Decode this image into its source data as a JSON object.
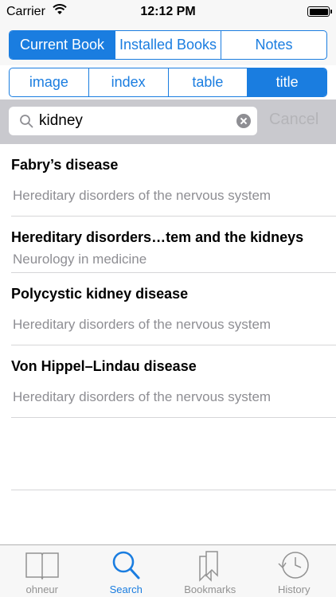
{
  "status_bar": {
    "carrier": "Carrier",
    "time": "12:12 PM"
  },
  "scope_tabs": [
    {
      "label": "Current Book",
      "active": true
    },
    {
      "label": "Installed Books",
      "active": false
    },
    {
      "label": "Notes",
      "active": false
    }
  ],
  "field_tabs": [
    {
      "label": "image",
      "active": false
    },
    {
      "label": "index",
      "active": false
    },
    {
      "label": "table",
      "active": false
    },
    {
      "label": "title",
      "active": true
    }
  ],
  "search": {
    "value": "kidney",
    "cancel_label": "Cancel"
  },
  "results": [
    {
      "title": "Fabry’s disease",
      "subtitle": "Hereditary disorders of the nervous system"
    },
    {
      "title": "Hereditary disorders…tem and the kidneys",
      "subtitle": "Neurology in medicine"
    },
    {
      "title": "Polycystic kidney disease",
      "subtitle": "Hereditary disorders of the nervous system"
    },
    {
      "title": "Von Hippel–Lindau disease",
      "subtitle": "Hereditary disorders of the nervous system"
    }
  ],
  "tab_bar": [
    {
      "label": "ohneur",
      "icon": "book-icon",
      "active": false
    },
    {
      "label": "Search",
      "icon": "search-icon",
      "active": true
    },
    {
      "label": "Bookmarks",
      "icon": "bookmarks-icon",
      "active": false
    },
    {
      "label": "History",
      "icon": "history-icon",
      "active": false
    }
  ],
  "colors": {
    "accent": "#1a7de0",
    "inactive": "#929292",
    "search_bg": "#c9c9ce"
  }
}
